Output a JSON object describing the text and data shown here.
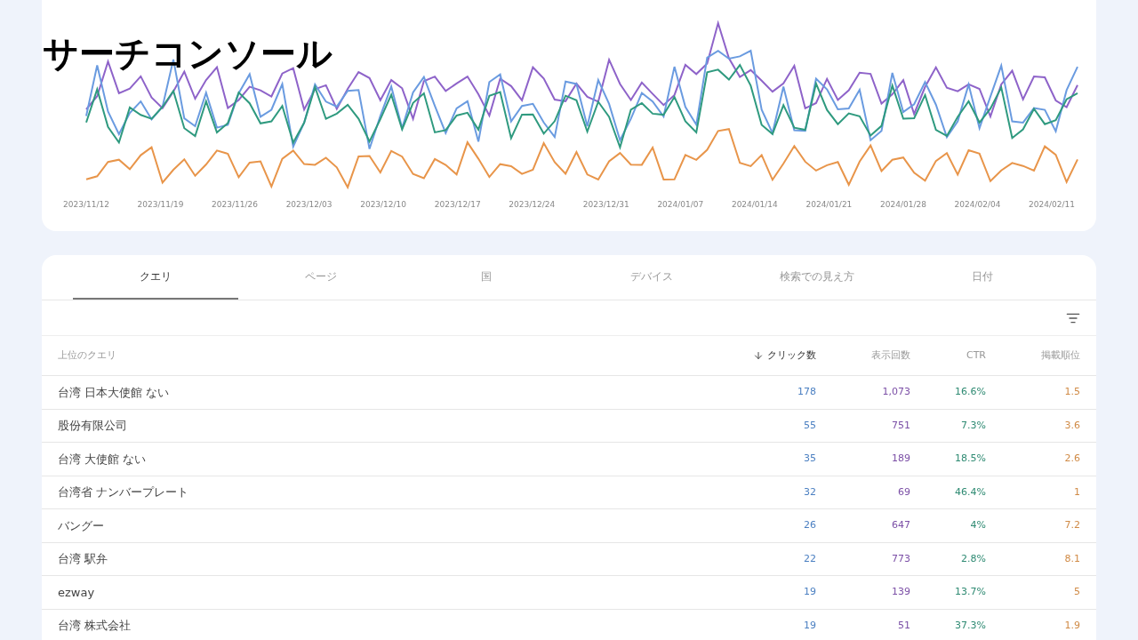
{
  "title": "サーチコンソール",
  "chart": {
    "x_labels": [
      "2023/11/12",
      "2023/11/19",
      "2023/11/26",
      "2023/12/03",
      "2023/12/10",
      "2023/12/17",
      "2023/12/24",
      "2023/12/31",
      "2024/01/07",
      "2024/01/14",
      "2024/01/21",
      "2024/01/28",
      "2024/02/04",
      "2024/02/11"
    ]
  },
  "tabs": [
    {
      "label": "クエリ",
      "selected": true
    },
    {
      "label": "ページ",
      "selected": false
    },
    {
      "label": "国",
      "selected": false
    },
    {
      "label": "デバイス",
      "selected": false
    },
    {
      "label": "検索での見え方",
      "selected": false
    },
    {
      "label": "日付",
      "selected": false
    }
  ],
  "table": {
    "columns": [
      {
        "label": "上位のクエリ",
        "sorted": false
      },
      {
        "label": "クリック数",
        "sorted": true
      },
      {
        "label": "表示回数",
        "sorted": false
      },
      {
        "label": "CTR",
        "sorted": false
      },
      {
        "label": "掲載順位",
        "sorted": false
      }
    ],
    "rows": [
      {
        "cells": [
          "台湾 日本大使館 ない",
          "178",
          "1,073",
          "16.6%",
          "1.5"
        ]
      },
      {
        "cells": [
          "股份有限公司",
          "55",
          "751",
          "7.3%",
          "3.6"
        ]
      },
      {
        "cells": [
          "台湾 大使館 ない",
          "35",
          "189",
          "18.5%",
          "2.6"
        ]
      },
      {
        "cells": [
          "台湾省 ナンバープレート",
          "32",
          "69",
          "46.4%",
          "1"
        ]
      },
      {
        "cells": [
          "バングー",
          "26",
          "647",
          "4%",
          "7.2"
        ]
      },
      {
        "cells": [
          "台湾 駅弁",
          "22",
          "773",
          "2.8%",
          "8.1"
        ]
      },
      {
        "cells": [
          "ezway",
          "19",
          "139",
          "13.7%",
          "5"
        ]
      },
      {
        "cells": [
          "台湾 株式会社",
          "19",
          "51",
          "37.3%",
          "1.9"
        ]
      }
    ]
  }
}
